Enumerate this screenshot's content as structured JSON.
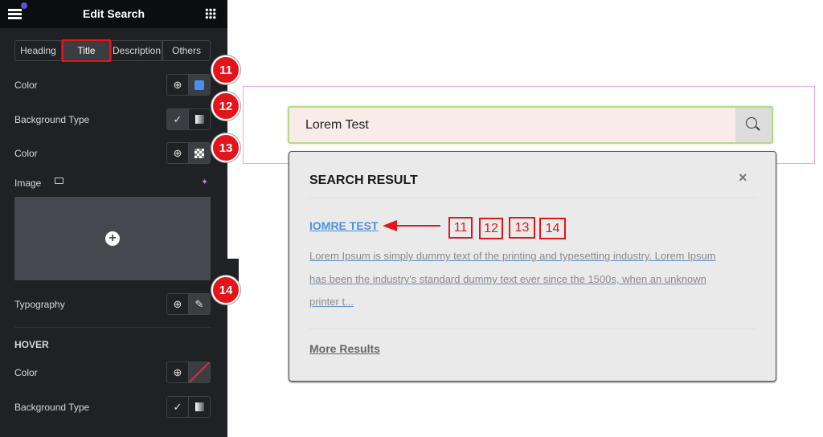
{
  "panel": {
    "title": "Edit Search",
    "tabs": [
      "Heading",
      "Title",
      "Description",
      "Others"
    ],
    "rows": {
      "color": "Color",
      "bg_type": "Background Type",
      "color2": "Color",
      "image": "Image",
      "typography": "Typography"
    },
    "hover": {
      "heading": "HOVER",
      "color": "Color",
      "bg_type": "Background Type"
    },
    "swatch_color": "#4a90f0"
  },
  "badges": [
    "11",
    "12",
    "13",
    "14"
  ],
  "search": {
    "value": "Lorem Test"
  },
  "results": {
    "heading": "SEARCH RESULT",
    "close": "×",
    "title": "IOMRE TEST",
    "desc_lines": [
      "Lorem Ipsum is simply dummy text of the printing and typesetting industry. Lorem Ipsum",
      "has been the industry's standard dummy text ever since the 1500s, when an unknown",
      "printer t..."
    ],
    "more": "More Results"
  },
  "annotation_boxes": [
    "11",
    "12",
    "13",
    "14"
  ]
}
